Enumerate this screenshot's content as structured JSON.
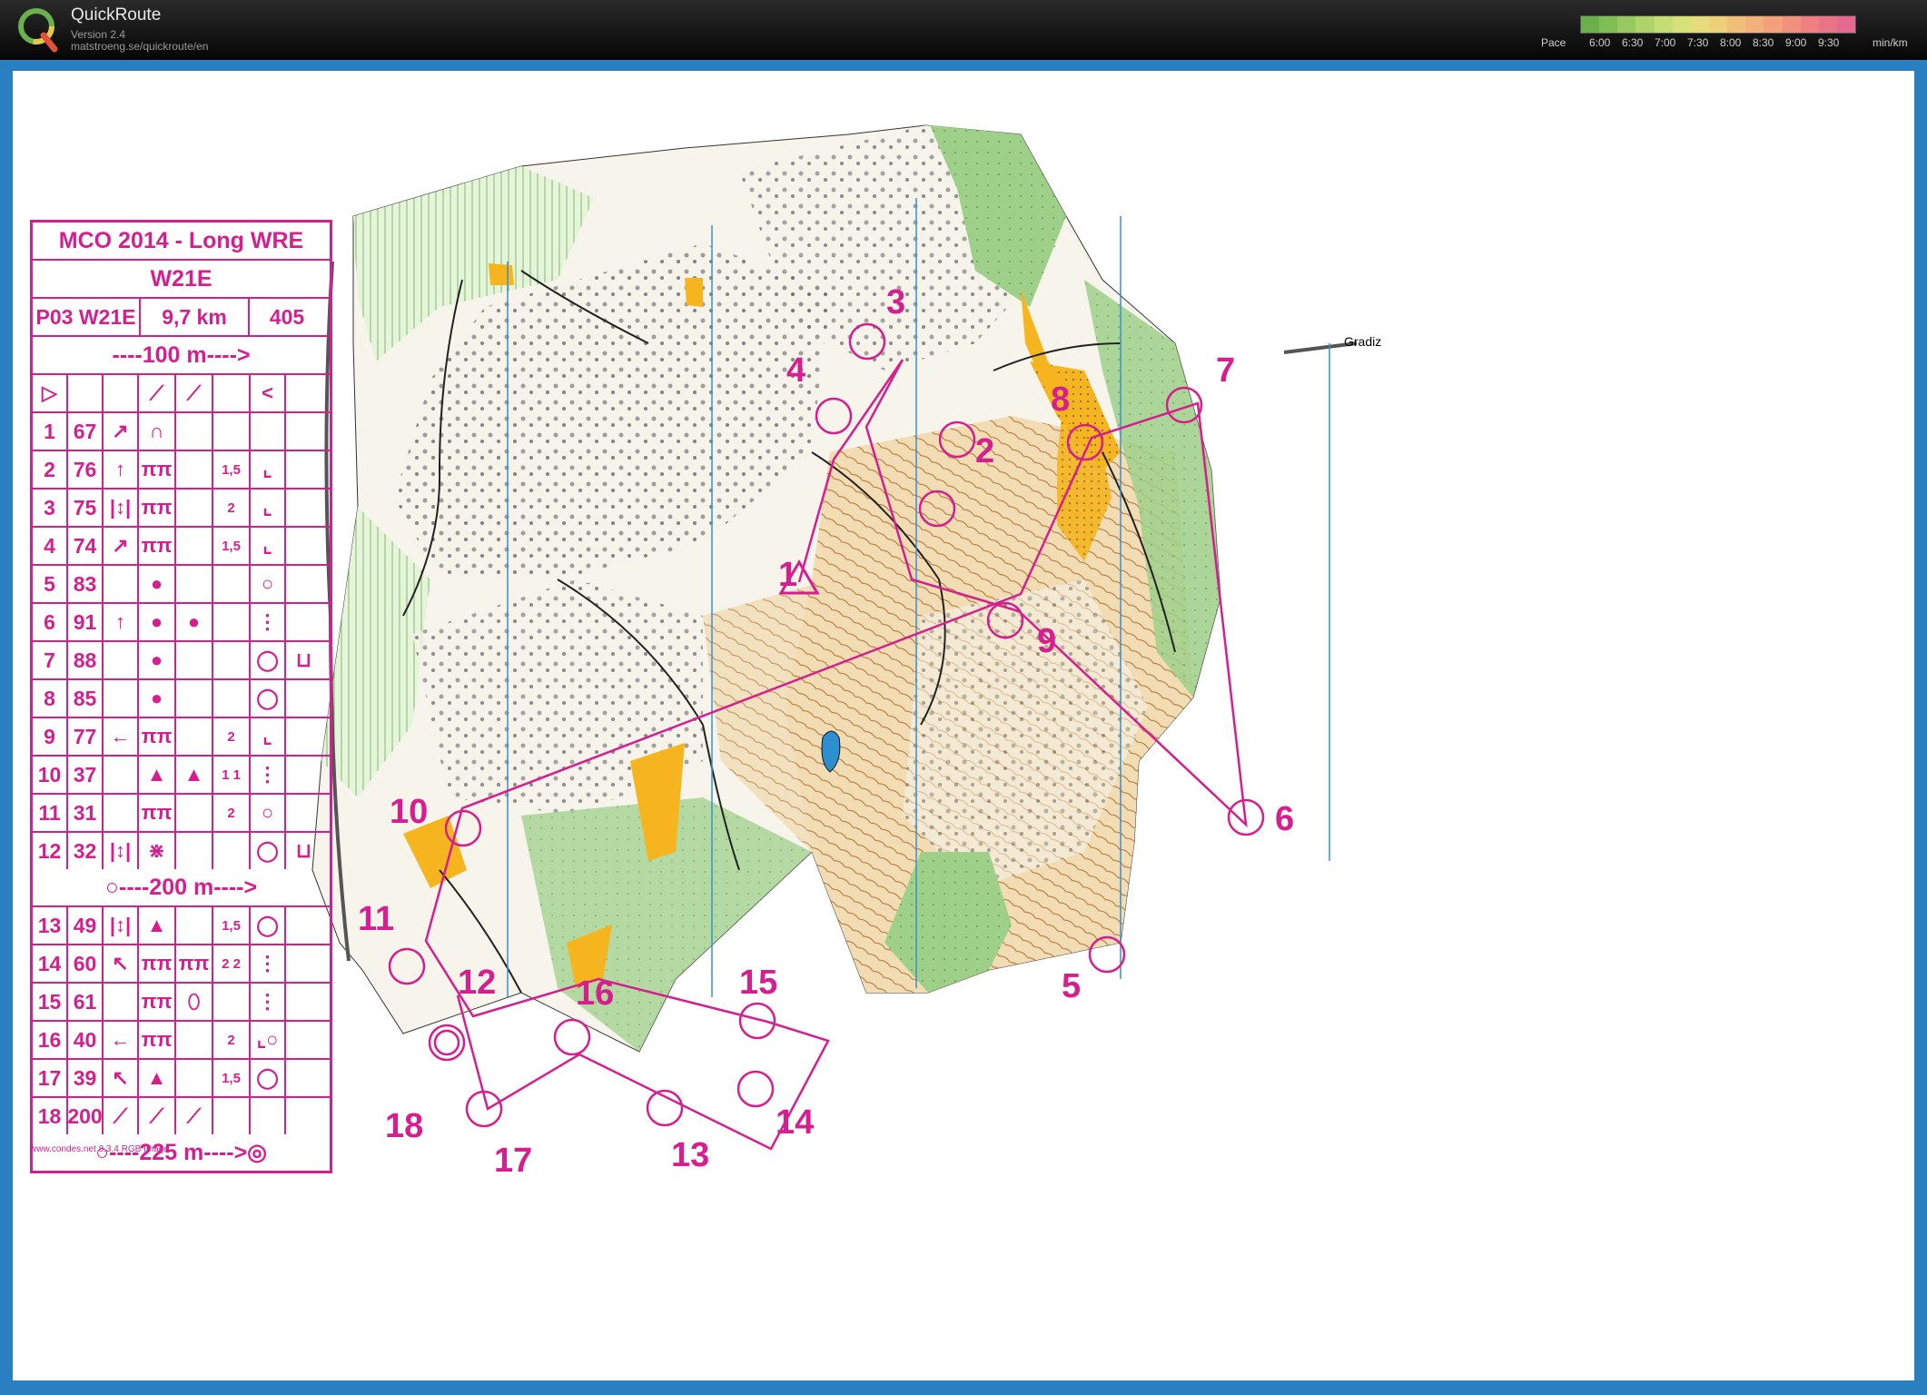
{
  "app": {
    "title": "QuickRoute",
    "version": "Version 2.4",
    "url": "matstroeng.se/quickroute/en",
    "icon": "quickroute-q-logo-icon"
  },
  "pace_scale": {
    "label": "Pace",
    "unit": "min/km",
    "ticks": [
      "6:00",
      "6:30",
      "7:00",
      "7:30",
      "8:00",
      "8:30",
      "9:00",
      "9:30"
    ],
    "colors": [
      "#6ab04c",
      "#7fbd55",
      "#96c95f",
      "#aed36a",
      "#c4dd74",
      "#d7e17a",
      "#e6dc7c",
      "#ecd07a",
      "#f0c07a",
      "#f2b07a",
      "#f3a07c",
      "#f2907e",
      "#ef8082",
      "#e97488",
      "#e36a8e"
    ]
  },
  "control_description": {
    "event": "MCO 2014 - Long WRE",
    "class": "W21E",
    "course": "P03 W21E",
    "length": "9,7 km",
    "climb": "405",
    "start_to_first": "----100 m---->",
    "header_symbols": [
      "▷",
      "",
      "",
      "⟋",
      "⟋",
      "<"
    ],
    "controls": [
      {
        "n": "1",
        "code": "67",
        "c": "↗",
        "d": "∩",
        "e": "",
        "f": "",
        "g": "",
        "h": ""
      },
      {
        "n": "2",
        "code": "76",
        "c": "↑",
        "d": "ππ",
        "e": "",
        "f": "1,5",
        "g": "⌞",
        "h": ""
      },
      {
        "n": "3",
        "code": "75",
        "c": "|↕|",
        "d": "ππ",
        "e": "",
        "f": "2",
        "g": "⌞",
        "h": ""
      },
      {
        "n": "4",
        "code": "74",
        "c": "↗",
        "d": "ππ",
        "e": "",
        "f": "1,5",
        "g": "⌞",
        "h": ""
      },
      {
        "n": "5",
        "code": "83",
        "c": "",
        "d": "●",
        "e": "",
        "f": "",
        "g": "○",
        "h": ""
      },
      {
        "n": "6",
        "code": "91",
        "c": "↑",
        "d": "●",
        "e": "●",
        "f": "",
        "g": "⋮",
        "h": ""
      },
      {
        "n": "7",
        "code": "88",
        "c": "",
        "d": "●",
        "e": "",
        "f": "",
        "g": "◯",
        "h": "⊔"
      },
      {
        "n": "8",
        "code": "85",
        "c": "",
        "d": "●",
        "e": "",
        "f": "",
        "g": "◯",
        "h": ""
      },
      {
        "n": "9",
        "code": "77",
        "c": "←",
        "d": "ππ",
        "e": "",
        "f": "2",
        "g": "⌞",
        "h": ""
      },
      {
        "n": "10",
        "code": "37",
        "c": "",
        "d": "▲",
        "e": "▲",
        "f": "1 1",
        "g": "⋮",
        "h": ""
      },
      {
        "n": "11",
        "code": "31",
        "c": "",
        "d": "ππ",
        "e": "",
        "f": "2",
        "g": "○",
        "h": ""
      },
      {
        "n": "12",
        "code": "32",
        "c": "|↕|",
        "d": "⋇",
        "e": "",
        "f": "",
        "g": "◯",
        "h": "⊔"
      }
    ],
    "mid_leg": "○----200 m---->",
    "controls2": [
      {
        "n": "13",
        "code": "49",
        "c": "|↕|",
        "d": "▲",
        "e": "",
        "f": "1,5",
        "g": "◯",
        "h": ""
      },
      {
        "n": "14",
        "code": "60",
        "c": "↖",
        "d": "ππ",
        "e": "ππ",
        "f": "2 2",
        "g": "⋮",
        "h": ""
      },
      {
        "n": "15",
        "code": "61",
        "c": "",
        "d": "ππ",
        "e": "⬯",
        "f": "",
        "g": "⋮",
        "h": ""
      },
      {
        "n": "16",
        "code": "40",
        "c": "←",
        "d": "ππ",
        "e": "",
        "f": "2",
        "g": "⌞○",
        "h": ""
      },
      {
        "n": "17",
        "code": "39",
        "c": "↖",
        "d": "▲",
        "e": "",
        "f": "1,5",
        "g": "◯",
        "h": ""
      },
      {
        "n": "18",
        "code": "200",
        "c": "⟋",
        "d": "⟋",
        "e": "⟋",
        "f": "",
        "g": "",
        "h": ""
      }
    ],
    "finish_leg": "○----225 m---->◎",
    "footer": "www.condes.net 8.3.4 RGB Image"
  },
  "map": {
    "place_label": "Gradiz",
    "controls": [
      "1",
      "2",
      "3",
      "4",
      "5",
      "6",
      "7",
      "8",
      "9",
      "10",
      "11",
      "12",
      "13",
      "14",
      "15",
      "16",
      "17",
      "18"
    ],
    "colors": {
      "course": "#d61f8e",
      "frame": "#2a7fc1",
      "meridian": "#3a8fd0"
    }
  }
}
